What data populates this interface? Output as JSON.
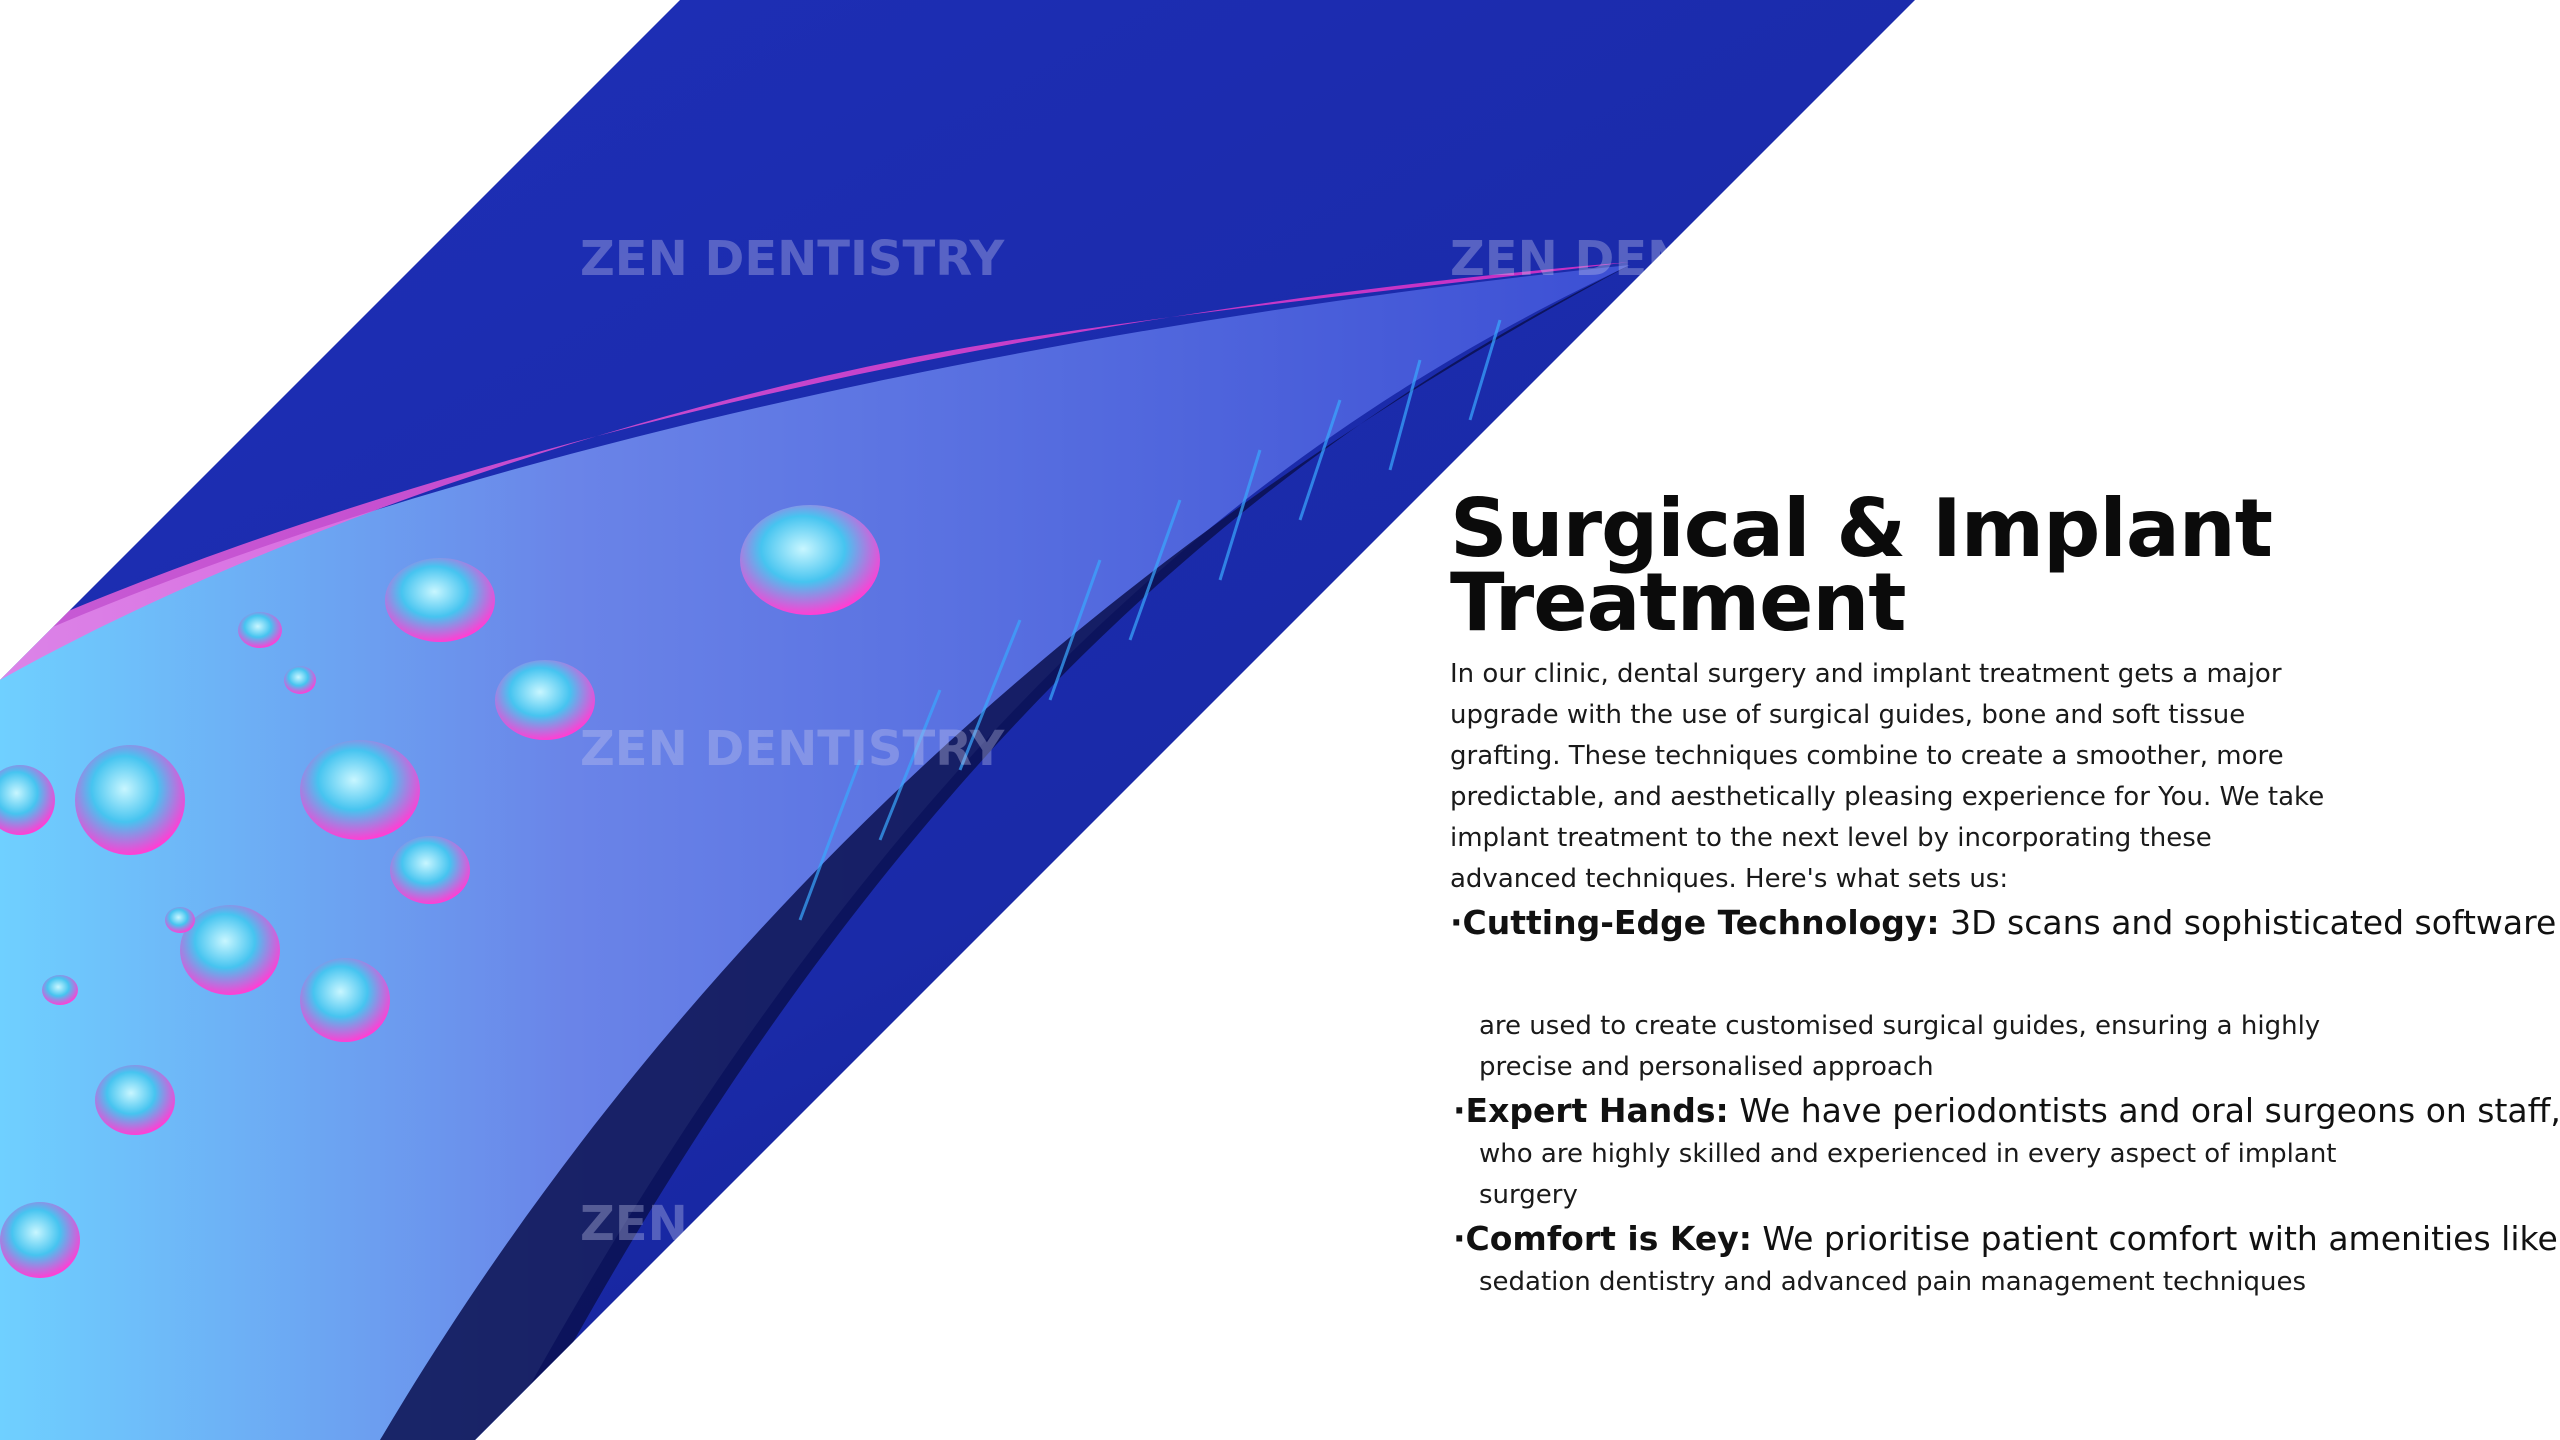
{
  "hero_image": {
    "alt": "Close-up of a surgical scalpel blade with water droplets under pink and blue light",
    "watermark_text": "ZEN DENTISTRY",
    "colors": {
      "deep_blue": "#0d1a8f",
      "mid_blue": "#2036c8",
      "magenta": "#ff3fd4",
      "cyan": "#5fd6ff"
    }
  },
  "content": {
    "title_line1": "Surgical & Implant",
    "title_line2": "Treatment",
    "intro_lines": [
      "In our clinic, dental surgery and implant treatment gets a major",
      "upgrade with the use of surgical guides, bone and soft tissue",
      "grafting. These techniques combine to create a smoother, more",
      "predictable, and aesthetically pleasing experience for You. We take",
      "implant treatment to the next level by incorporating these",
      "advanced techniques. Here's what sets us:"
    ],
    "bullets": [
      {
        "marker": "·",
        "heading": "Cutting-Edge Technology:",
        "lead": "3D scans and sophisticated software",
        "body_lines": [
          "are used to create customised surgical guides, ensuring a highly",
          "precise and personalised approach"
        ]
      },
      {
        "marker": "·",
        "heading": "Expert Hands:",
        "lead": "We have periodontists and oral surgeons on staff,",
        "body_lines": [
          "who are highly skilled and experienced in every aspect of implant",
          "surgery"
        ]
      },
      {
        "marker": "·",
        "heading": "Comfort is Key:",
        "lead": "We prioritise patient comfort with amenities like",
        "body_lines": [
          "sedation dentistry and advanced pain management techniques"
        ]
      }
    ]
  }
}
